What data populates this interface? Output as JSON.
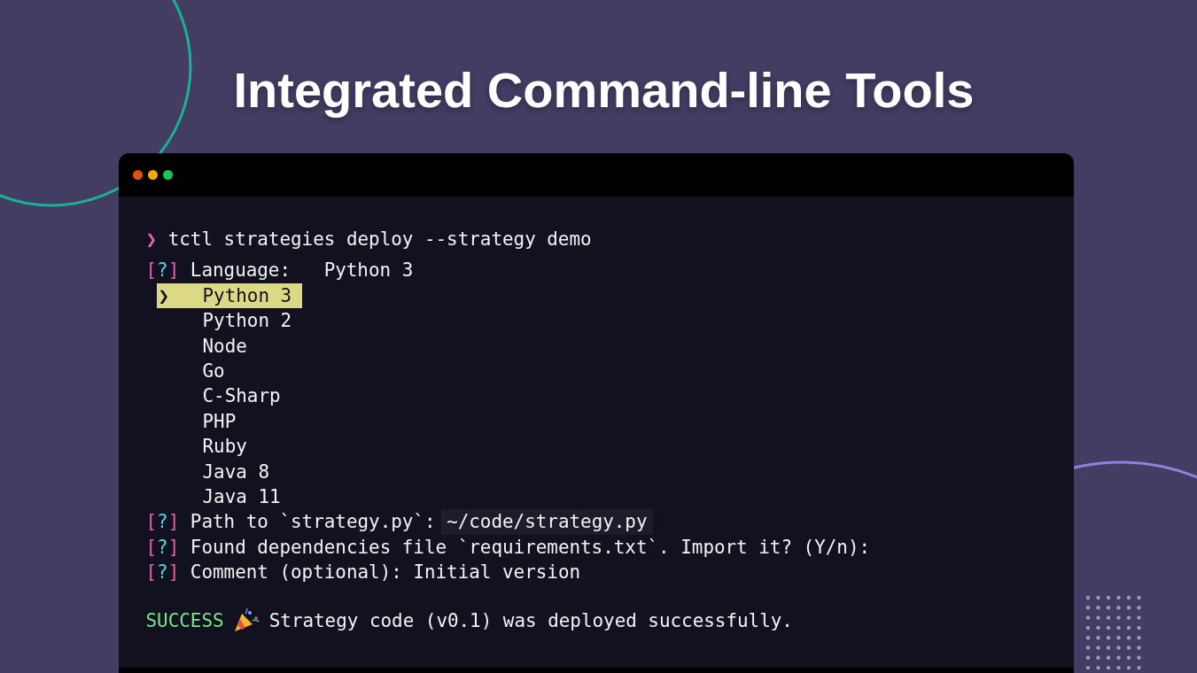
{
  "title": "Integrated Command-line Tools",
  "terminal": {
    "lines": [
      {
        "kind": "command",
        "prompt": "❯",
        "text": "tctl strategies deploy --strategy demo"
      },
      {
        "kind": "select",
        "mark": "[?]",
        "label": "Language:",
        "answer": "Python 3",
        "field": false
      },
      {
        "kind": "menu",
        "pointer": "❯",
        "options": [
          {
            "label": "Python 3",
            "selected": true
          },
          {
            "label": "Python 2",
            "selected": false
          },
          {
            "label": "Node",
            "selected": false
          },
          {
            "label": "Go",
            "selected": false
          },
          {
            "label": "C-Sharp",
            "selected": false
          },
          {
            "label": "PHP",
            "selected": false
          },
          {
            "label": "Ruby",
            "selected": false
          },
          {
            "label": "Java 8",
            "selected": false
          },
          {
            "label": "Java 11",
            "selected": false
          }
        ]
      },
      {
        "kind": "question",
        "mark": "[?]",
        "label": "Path to `strategy.py`:",
        "answer": "~/code/strategy.py",
        "field": true
      },
      {
        "kind": "question",
        "mark": "[?]",
        "label": "Found dependencies file `requirements.txt`. Import it? (Y/n):"
      },
      {
        "kind": "question",
        "mark": "[?]",
        "label": "Comment (optional):",
        "answer": "Initial version",
        "field": false
      },
      {
        "kind": "result",
        "status": "SUCCESS",
        "text": "Strategy code (v0.1) was deployed successfully."
      }
    ]
  }
}
